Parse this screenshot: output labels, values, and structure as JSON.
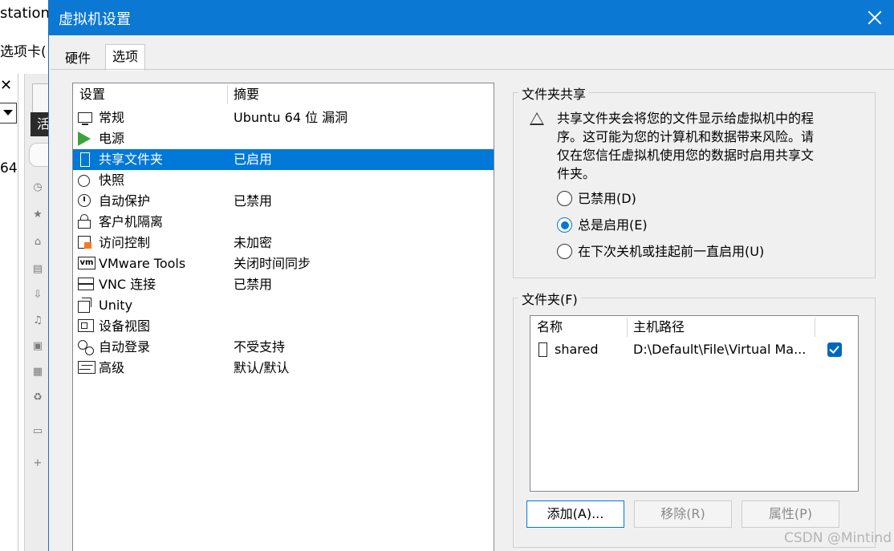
{
  "background_app": {
    "title_fragment": "station",
    "menu_fragment": "选项卡(",
    "close_glyph": "✕",
    "number_fragment": "64",
    "tab_fragment": "活"
  },
  "dialog": {
    "title": "虚拟机设置",
    "tabs": [
      {
        "label": "硬件",
        "selected": false
      },
      {
        "label": "选项",
        "selected": true
      }
    ],
    "settings_list": {
      "headers": {
        "setting": "设置",
        "summary": "摘要"
      },
      "items": [
        {
          "label": "常规",
          "summary": "Ubuntu 64 位 漏洞",
          "icon": "monitor-icon"
        },
        {
          "label": "电源",
          "summary": "",
          "icon": "power-play-icon"
        },
        {
          "label": "共享文件夹",
          "summary": "已启用",
          "icon": "shared-folder-icon",
          "selected": true
        },
        {
          "label": "快照",
          "summary": "",
          "icon": "snapshot-icon"
        },
        {
          "label": "自动保护",
          "summary": "已禁用",
          "icon": "clock-icon"
        },
        {
          "label": "客户机隔离",
          "summary": "",
          "icon": "lock-icon"
        },
        {
          "label": "访问控制",
          "summary": "未加密",
          "icon": "access-control-icon"
        },
        {
          "label": "VMware Tools",
          "summary": "关闭时间同步",
          "icon": "vmware-tools-icon"
        },
        {
          "label": "VNC 连接",
          "summary": "已禁用",
          "icon": "vnc-icon"
        },
        {
          "label": "Unity",
          "summary": "",
          "icon": "unity-icon"
        },
        {
          "label": "设备视图",
          "summary": "",
          "icon": "device-view-icon"
        },
        {
          "label": "自动登录",
          "summary": "不受支持",
          "icon": "users-icon"
        },
        {
          "label": "高级",
          "summary": "默认/默认",
          "icon": "advanced-wave-icon"
        }
      ]
    },
    "folder_sharing": {
      "title": "文件夹共享",
      "warning": "共享文件夹会将您的文件显示给虚拟机中的程序。这可能为您的计算机和数据带来风险。请仅在您信任虚拟机使用您的数据时启用共享文件夹。",
      "options": [
        {
          "label": "已禁用(D)",
          "checked": false
        },
        {
          "label": "总是启用(E)",
          "checked": true
        },
        {
          "label": "在下次关机或挂起前一直启用(U)",
          "checked": false
        }
      ]
    },
    "folders": {
      "title": "文件夹(F)",
      "columns": {
        "name": "名称",
        "host_path": "主机路径"
      },
      "rows": [
        {
          "name": "shared",
          "host_path": "D:\\Default\\File\\Virtual Ma...",
          "enabled": true
        }
      ],
      "buttons": {
        "add": "添加(A)...",
        "remove": "移除(R)",
        "properties": "属性(P)"
      }
    }
  },
  "watermark": "CSDN @Mintind",
  "colors": {
    "titlebar": "#0b78d4",
    "selection": "#0078d7",
    "power_icon": "#3da23d",
    "checkbox": "#0067c0"
  }
}
